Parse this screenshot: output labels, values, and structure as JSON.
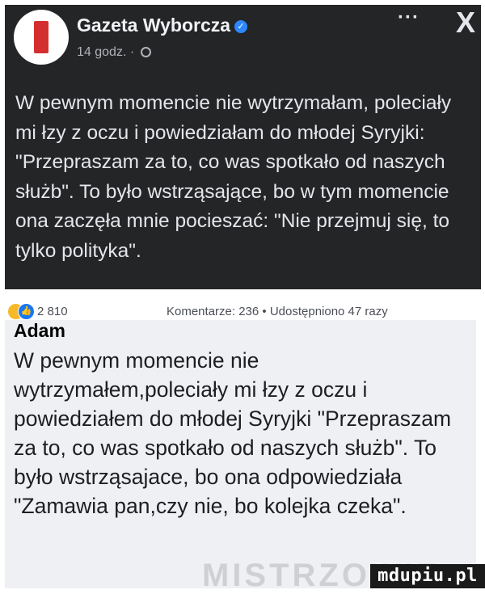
{
  "post": {
    "page_name": "Gazeta Wyborcza",
    "verified_icon": "verified-check-icon",
    "time": "14 godz. ·",
    "privacy_icon": "globe-icon",
    "more_label": "···",
    "close_label": "X",
    "text": "W pewnym momencie nie wytrzymałam, poleciały mi łzy z oczu i powiedziałam do młodej Syryjki: \"Przepraszam za to, co was spotkało od naszych służb\". To było wstrząsające, bo w tym momencie ona zaczęła mnie pocieszać: \"Nie przejmuj się, to tylko polityka\"."
  },
  "stats": {
    "reaction_count": "2 810",
    "summary": "Komentarze: 236 • Udostępniono 47 razy"
  },
  "comment": {
    "author": "Adam",
    "text": "W pewnym momencie nie wytrzymałem,poleciały mi łzy z oczu i powiedziałem do młodej Syryjki \"Przepraszam za to, co was spotkało od naszych służb\". To było wstrząsajace, bo ona odpowiedziała \"Zamawia pan,czy nie, bo kolejka czeka\"."
  },
  "watermark": {
    "faint": "MISTRZOWIE",
    "site": "mdupiu.pl"
  },
  "colors": {
    "post_bg": "#242526",
    "comment_bg": "#eef0f3",
    "like_blue": "#1877f2",
    "brand_red": "#d32f2f"
  }
}
